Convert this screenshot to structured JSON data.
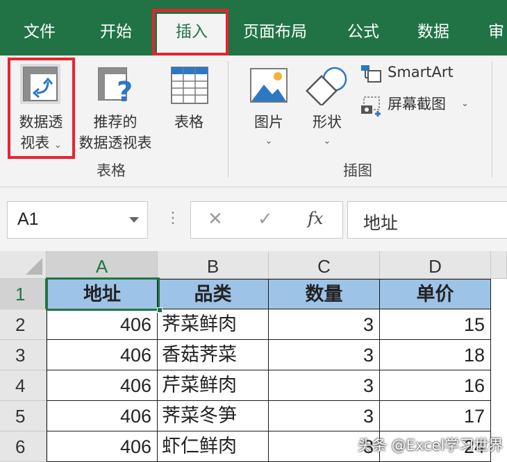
{
  "menu": {
    "tabs": [
      {
        "label": "文件"
      },
      {
        "label": "开始"
      },
      {
        "label": "插入"
      },
      {
        "label": "页面布局"
      },
      {
        "label": "公式"
      },
      {
        "label": "数据"
      },
      {
        "label": "审"
      }
    ],
    "active_tab": "插入",
    "accent_color": "#217346",
    "highlight_color": "#e8232f"
  },
  "ribbon": {
    "groups": [
      {
        "label": "表格",
        "buttons": [
          {
            "label_line1": "数据透",
            "label_line2": "视表",
            "icon": "pivot-table-icon"
          },
          {
            "label_line1": "推荐的",
            "label_line2": "数据透视表",
            "icon": "recommended-pivot-icon"
          },
          {
            "label_line1": "表格",
            "icon": "table-icon"
          }
        ]
      },
      {
        "label": "插图",
        "buttons": [
          {
            "label_line1": "图片",
            "icon": "picture-icon"
          },
          {
            "label_line1": "形状",
            "icon": "shapes-icon"
          },
          {
            "label_line1": "SmartArt",
            "icon": "smartart-icon"
          },
          {
            "label_line1": "屏幕截图",
            "icon": "screenshot-icon"
          }
        ]
      }
    ]
  },
  "formula_bar": {
    "name_box": "A1",
    "cancel_symbol": "✕",
    "enter_symbol": "✓",
    "fx_label": "fx",
    "formula": "地址"
  },
  "sheet": {
    "columns": [
      "A",
      "B",
      "C",
      "D"
    ],
    "rows": [
      "1",
      "2",
      "3",
      "4",
      "5",
      "6"
    ],
    "header": [
      "地址",
      "品类",
      "数量",
      "单价"
    ],
    "data": [
      [
        "406",
        "荠菜鲜肉",
        "3",
        "15"
      ],
      [
        "406",
        "香菇荠菜",
        "3",
        "18"
      ],
      [
        "406",
        "芹菜鲜肉",
        "3",
        "16"
      ],
      [
        "406",
        "荠菜冬笋",
        "3",
        "17"
      ],
      [
        "406",
        "虾仁鲜肉",
        "3",
        "24"
      ]
    ],
    "header_fill": "#9dc3e6",
    "selected_cell": "A1"
  },
  "watermark": "头条 @Excel学习世界"
}
